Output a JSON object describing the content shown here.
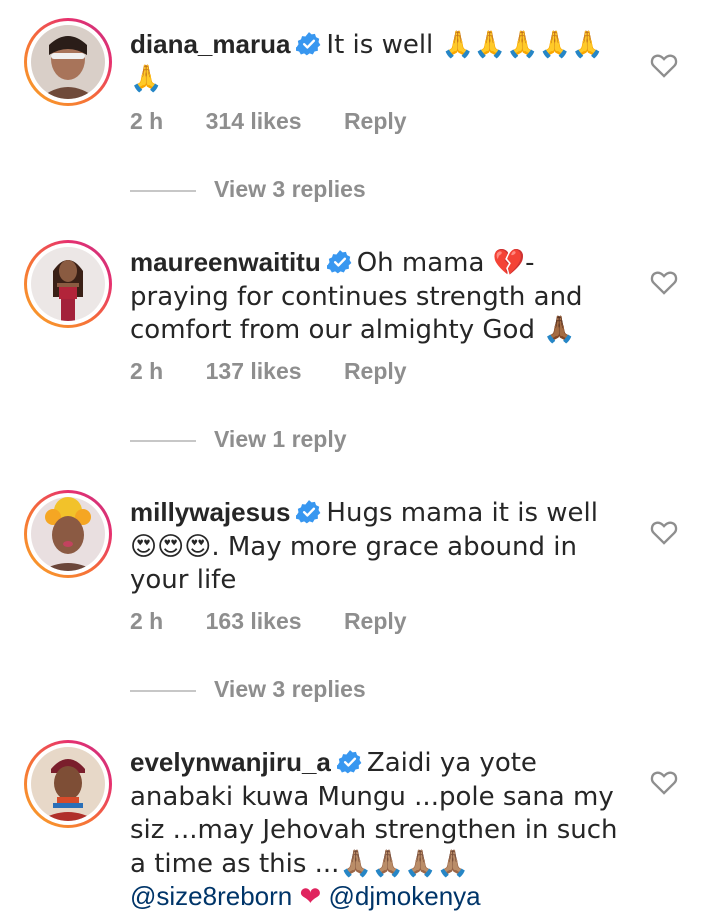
{
  "comments": [
    {
      "username": "diana_marua",
      "text": "It is well 🙏🙏🙏🙏🙏🙏",
      "time": "2 h",
      "likes": "314 likes",
      "reply": "Reply",
      "replies": "View 3 replies"
    },
    {
      "username": "maureenwaititu",
      "text": "Oh mama 💔- praying for continues strength and comfort from our almighty God 🙏🏾",
      "time": "2 h",
      "likes": "137 likes",
      "reply": "Reply",
      "replies": "View 1 reply"
    },
    {
      "username": "millywajesus",
      "text": "Hugs mama it is well 😍😍😍. May more grace abound in your life",
      "time": "2 h",
      "likes": "163 likes",
      "reply": "Reply",
      "replies": "View 3 replies"
    },
    {
      "username": "evelynwanjiru_a",
      "text": "Zaidi ya yote anabaki kuwa Mungu ...pole sana my siz ...may Jehovah strengthen in such a time as this ...🙏🏽🙏🏽🙏🏽🙏🏽",
      "mention1": "@size8reborn",
      "heart_emoji": "❤",
      "mention2": "@djmokenya"
    }
  ],
  "colors": {
    "text": "#262626",
    "secondary": "#8e8e8e",
    "verified": "#3897f0",
    "mention": "#003569"
  }
}
